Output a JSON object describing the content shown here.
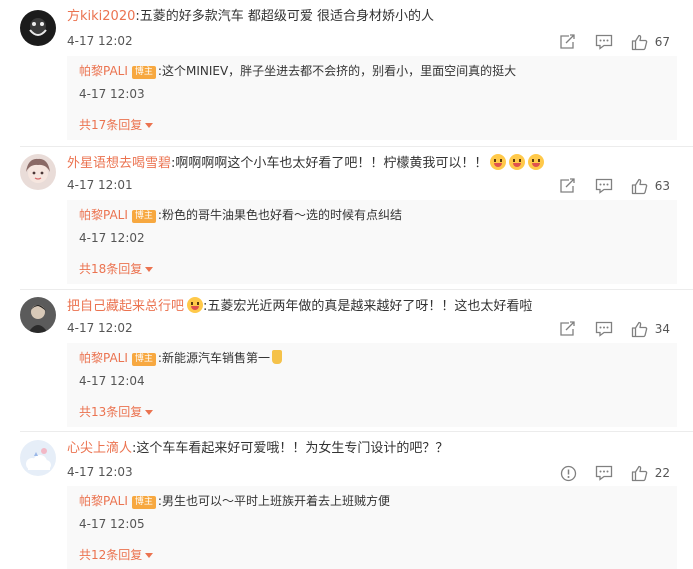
{
  "comments": [
    {
      "username": "方kiki2020",
      "text": "五菱的好多款汽车 都超级可爱 很适合身材娇小的人",
      "time": "4-17 12:02",
      "likes": "67",
      "reply": {
        "username": "帕黎PALI",
        "badge": "博主",
        "text": "这个MINIEV，胖子坐进去都不会挤的，别看小，里面空间真的挺大",
        "time": "4-17 12:03"
      },
      "more": "共17条回复"
    },
    {
      "username": "外星语想去喝雪碧",
      "text": "啊啊啊啊这个小车也太好看了吧！！柠檬黄我可以！！",
      "time": "4-17 12:01",
      "likes": "63",
      "reply": {
        "username": "帕黎PALI",
        "badge": "博主",
        "text": "粉色的哥牛油果色也好看～选的时候有点纠结",
        "time": "4-17 12:02"
      },
      "more": "共18条回复"
    },
    {
      "username": "把自己藏起来总行吧",
      "text": "五菱宏光近两年做的真是越来越好了呀！！这也太好看啦",
      "time": "4-17 12:02",
      "likes": "34",
      "reply": {
        "username": "帕黎PALI",
        "badge": "博主",
        "text": "新能源汽车销售第一",
        "time": "4-17 12:04"
      },
      "more": "共13条回复"
    },
    {
      "username": "心尖上滴人",
      "text": "这个车车看起来好可爱哦！！为女生专门设计的吧？？",
      "time": "4-17 12:03",
      "likes": "22",
      "reply": {
        "username": "帕黎PALI",
        "badge": "博主",
        "text": "男生也可以～平时上班族开着去上班贼方便",
        "time": "4-17 12:05"
      },
      "more": "共12条回复"
    }
  ],
  "separator": ":"
}
